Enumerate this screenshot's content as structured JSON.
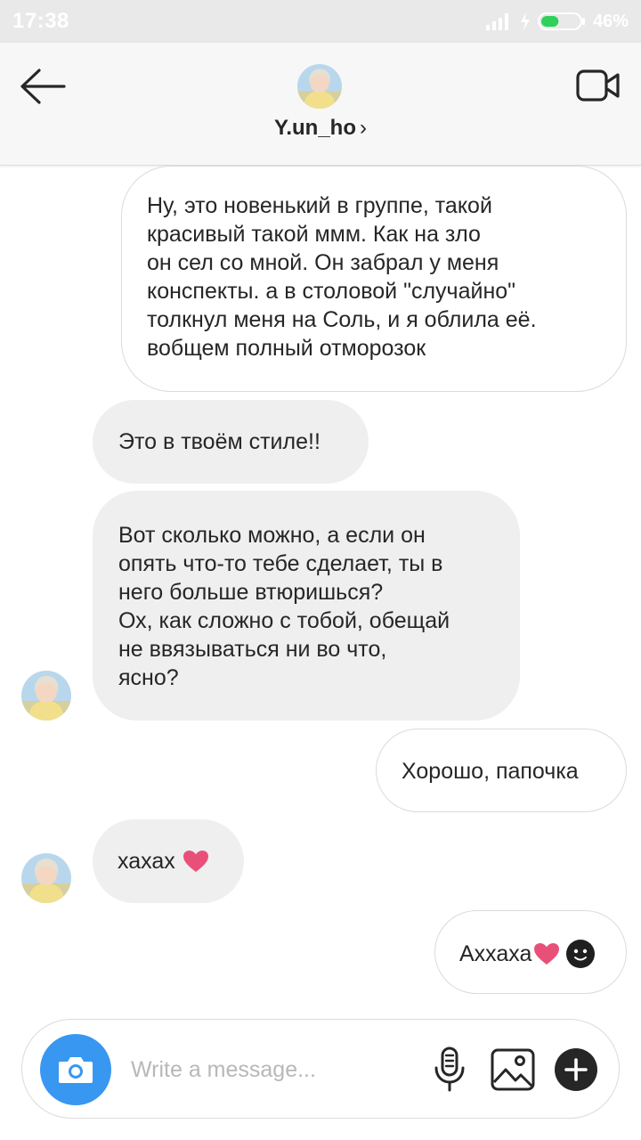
{
  "status_bar": {
    "time": "17:38",
    "battery_percent": "46%",
    "battery_level": 0.46,
    "icons": [
      "signal-icon",
      "charging-icon",
      "battery-icon"
    ]
  },
  "header": {
    "contact_name": "Y.un_ho",
    "chevron": "›",
    "back_icon": "arrow-left-icon",
    "video_icon": "video-call-icon"
  },
  "messages": [
    {
      "direction": "outgoing",
      "lines": [
        "Ну, это новенький в группе, такой",
        "красивый такой ммм. Как на зло",
        "он сел со мной. Он забрал у меня",
        "конспекты. а в столовой \"случайно\"",
        "толкнул меня на Соль, и я облила её.",
        "вобщем полный отморозок"
      ]
    },
    {
      "direction": "incoming",
      "lines": [
        "Это в твоём стиле!!"
      ]
    },
    {
      "direction": "incoming",
      "lines": [
        "Вот сколько можно, а если он",
        "опять что-то тебе сделает, ты в",
        "него больше втюришься?",
        "Ох, как сложно с тобой, обещай",
        "не ввязываться ни во что,",
        "ясно?"
      ]
    },
    {
      "direction": "outgoing",
      "lines": [
        "Хорошо, папочка"
      ]
    },
    {
      "direction": "incoming",
      "lines": [
        "хахах"
      ],
      "emoji": [
        "heart-emoji"
      ]
    },
    {
      "direction": "outgoing",
      "lines": [
        "Аххаха"
      ],
      "emoji": [
        "heart-emoji",
        "dark-smiley-emoji"
      ]
    }
  ],
  "composer": {
    "placeholder": "Write a message...",
    "value": "",
    "camera_icon": "camera-icon",
    "mic_icon": "microphone-icon",
    "gallery_icon": "image-icon",
    "plus_icon": "plus-icon"
  },
  "colors": {
    "accent_blue": "#3897f0",
    "incoming_bubble": "#efefef",
    "outgoing_border": "#dbdbdb",
    "heart": "#e8507a",
    "text": "#262626"
  }
}
